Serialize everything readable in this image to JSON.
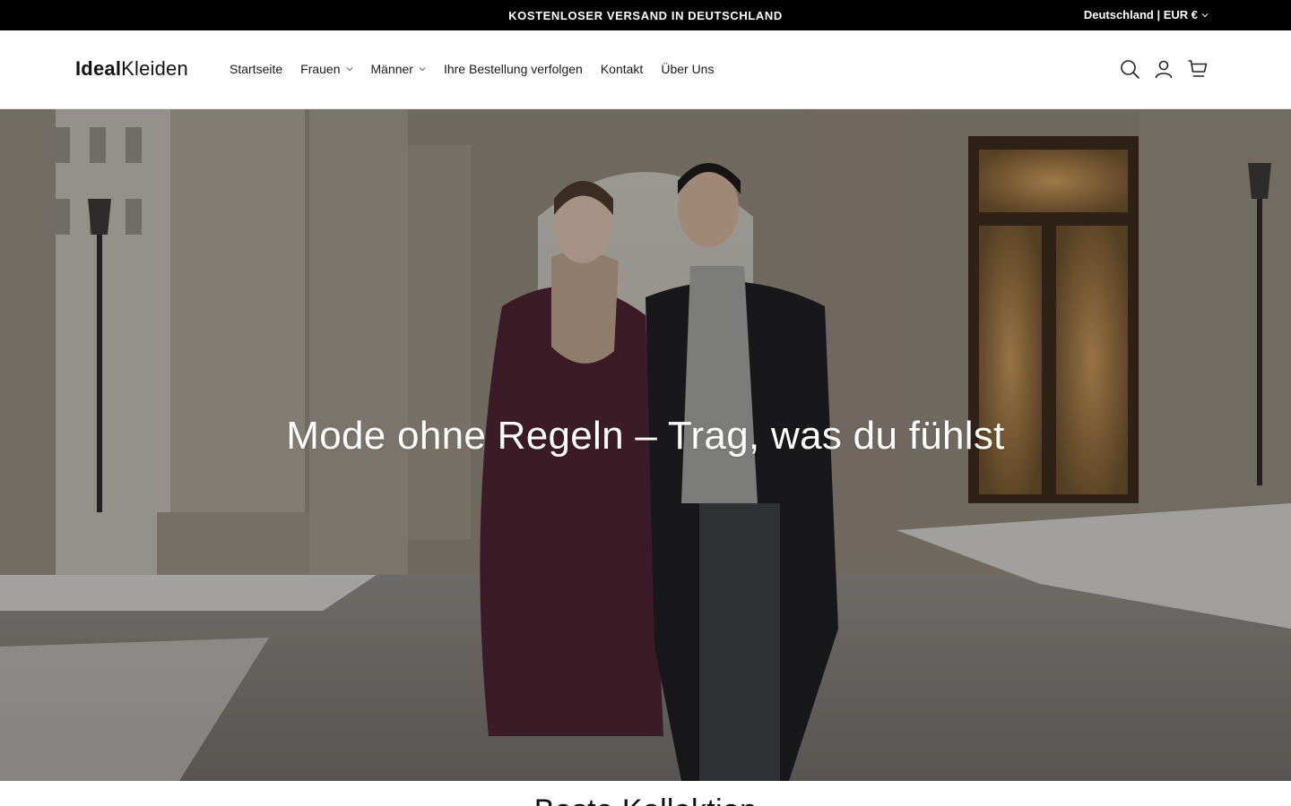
{
  "announcement": {
    "text": "KOSTENLOSER VERSAND IN DEUTSCHLAND",
    "locale_label": "Deutschland | EUR €"
  },
  "header": {
    "logo_bold": "Ideal",
    "logo_light": "Kleiden",
    "nav": [
      {
        "label": "Startseite",
        "has_dropdown": false
      },
      {
        "label": "Frauen",
        "has_dropdown": true
      },
      {
        "label": "Männer",
        "has_dropdown": true
      },
      {
        "label": "Ihre Bestellung verfolgen",
        "has_dropdown": false
      },
      {
        "label": "Kontakt",
        "has_dropdown": false
      },
      {
        "label": "Über Uns",
        "has_dropdown": false
      }
    ],
    "icons": [
      "search-icon",
      "account-icon",
      "cart-icon"
    ]
  },
  "hero": {
    "title": "Mode ohne Regeln – Trag, was du fühlst"
  },
  "section": {
    "heading": "Beste Kollektion"
  },
  "colors": {
    "announcement_bg": "#000000",
    "header_bg": "#ffffff",
    "text": "#121212"
  }
}
